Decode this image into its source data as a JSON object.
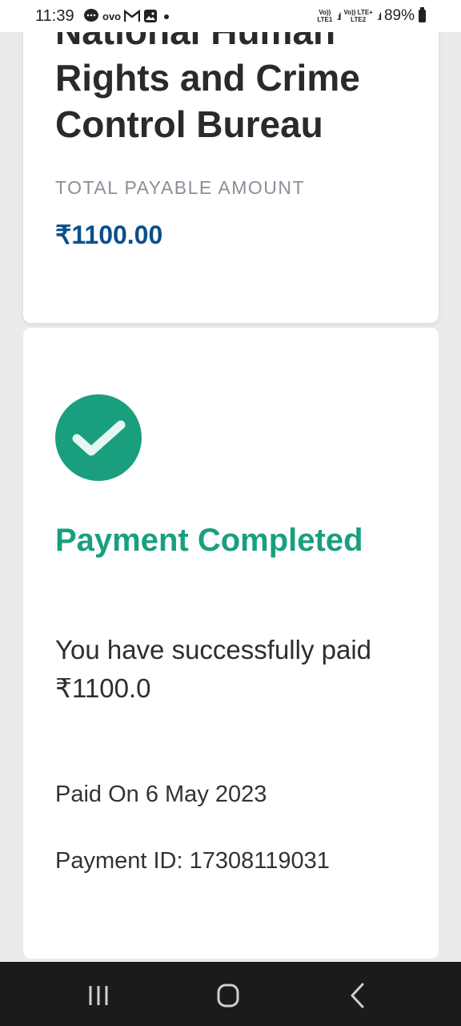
{
  "status_bar": {
    "time": "11:39",
    "notifications": [
      "message-icon",
      "ovo-icon",
      "gmail-icon",
      "gallery-icon",
      "dot-icon"
    ],
    "ovo_label": "ovo",
    "sim1": {
      "line1": "Vo))",
      "line2": "LTE1"
    },
    "sim2": {
      "line1": "Vo)) LTE+",
      "line2": "LTE2"
    },
    "signal_bars": ".ıl",
    "battery": "89%"
  },
  "merchant_card": {
    "org_name": "National Human Rights and Crime Control Bureau",
    "amount_label": "TOTAL PAYABLE AMOUNT",
    "amount_value": "₹1100.00"
  },
  "success_card": {
    "icon": "check-circle-icon",
    "title": "Payment Completed",
    "message": "You have successfully paid ₹1100.0",
    "paid_on": "Paid On 6 May 2023",
    "payment_id": "Payment ID: 17308119031"
  },
  "nav_bar": {
    "recent_icon": "recent-apps-icon",
    "home_icon": "home-icon",
    "back_icon": "back-icon"
  },
  "colors": {
    "success": "#1a9f7e",
    "amount": "#0c4f8a",
    "nav_bg": "#1b1b1d"
  }
}
